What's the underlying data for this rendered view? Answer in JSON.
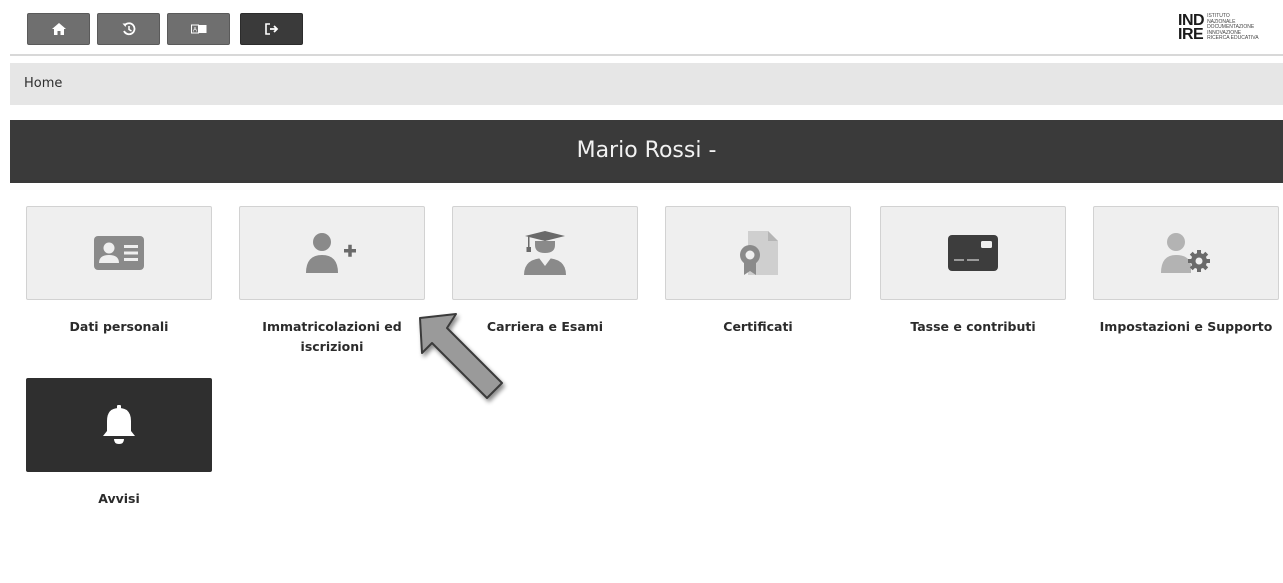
{
  "toolbar": {
    "buttons": [
      {
        "icon": "home-icon"
      },
      {
        "icon": "history-icon"
      },
      {
        "icon": "language-icon"
      },
      {
        "icon": "logout-icon"
      }
    ]
  },
  "logo": {
    "big_line1": "IND",
    "big_line2": "IRE",
    "small_lines": [
      "ISTITUTO",
      "NAZIONALE",
      "DOCUMENTAZIONE",
      "INNOVAZIONE",
      "RICERCA EDUCATIVA"
    ]
  },
  "breadcrumb": {
    "current": "Home"
  },
  "banner": {
    "title": "Mario Rossi -"
  },
  "tiles": [
    {
      "label_line1": "Dati personali",
      "label_line2": "",
      "icon": "id-card-icon"
    },
    {
      "label_line1": "Immatricolazioni ed",
      "label_line2": "iscrizioni",
      "icon": "add-user-icon"
    },
    {
      "label_line1": "Carriera e Esami",
      "label_line2": "",
      "icon": "graduate-icon"
    },
    {
      "label_line1": "Certificati",
      "label_line2": "",
      "icon": "certificate-icon"
    },
    {
      "label_line1": "Tasse e contributi",
      "label_line2": "",
      "icon": "credit-card-icon"
    },
    {
      "label_line1": "Impostazioni e Supporto",
      "label_line2": "",
      "icon": "user-settings-icon"
    },
    {
      "label_line1": "Avvisi",
      "label_line2": "",
      "icon": "bell-icon"
    }
  ],
  "colors": {
    "banner": "#3a3a3a",
    "tile_bg": "#efefef",
    "icon_gray": "#8a8a8a",
    "button_gray": "#6f6f6f"
  }
}
